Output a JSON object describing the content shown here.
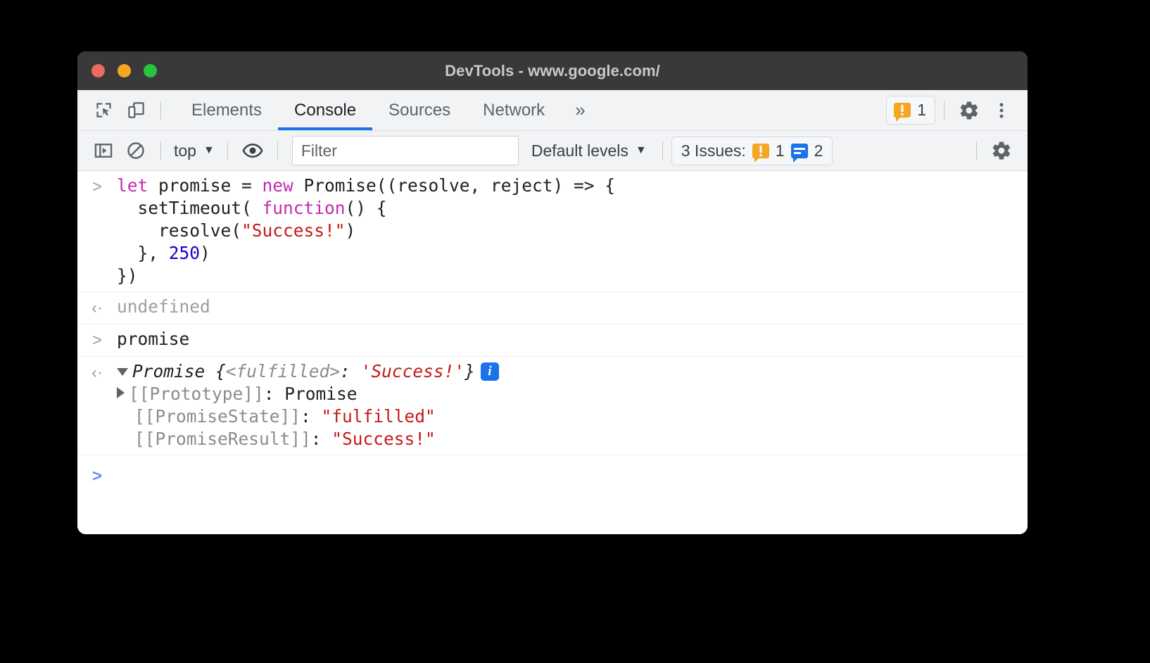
{
  "window": {
    "title": "DevTools - www.google.com/",
    "traffic_lights": [
      "close",
      "minimize",
      "maximize"
    ]
  },
  "tabbar": {
    "inspect_icon": "inspect-element-icon",
    "device_icon": "device-toolbar-icon",
    "tabs": [
      {
        "label": "Elements",
        "active": false
      },
      {
        "label": "Console",
        "active": true
      },
      {
        "label": "Sources",
        "active": false
      },
      {
        "label": "Network",
        "active": false
      }
    ],
    "more_tabs": "»",
    "warning_badge": {
      "icon": "warning-icon",
      "count": "1"
    },
    "settings_icon": "gear-icon",
    "menu_icon": "kebab-menu-icon"
  },
  "console_toolbar": {
    "sidebar_icon": "console-sidebar-icon",
    "clear_icon": "clear-console-icon",
    "context": {
      "label": "top",
      "caret": "▼"
    },
    "eye_icon": "live-expression-eye-icon",
    "filter": {
      "placeholder": "Filter",
      "value": ""
    },
    "levels": {
      "label": "Default levels",
      "caret": "▼"
    },
    "issues": {
      "label": "3 Issues:",
      "warning_count": "1",
      "info_count": "2"
    },
    "settings_icon": "console-settings-gear-icon"
  },
  "console": {
    "messages": [
      {
        "type": "input",
        "gutter": ">",
        "lines": [
          [
            {
              "t": "let ",
              "c": "k-kw"
            },
            {
              "t": "promise = ",
              "c": ""
            },
            {
              "t": "new ",
              "c": "k-kw"
            },
            {
              "t": "Promise((resolve, reject) => {",
              "c": ""
            }
          ],
          [
            {
              "t": "  setTimeout( ",
              "c": ""
            },
            {
              "t": "function",
              "c": "k-kw"
            },
            {
              "t": "() {",
              "c": ""
            }
          ],
          [
            {
              "t": "    resolve(",
              "c": ""
            },
            {
              "t": "\"Success!\"",
              "c": "k-str"
            },
            {
              "t": ")",
              "c": ""
            }
          ],
          [
            {
              "t": "  }, ",
              "c": ""
            },
            {
              "t": "250",
              "c": "k-num"
            },
            {
              "t": ")",
              "c": ""
            }
          ],
          [
            {
              "t": "})",
              "c": ""
            }
          ]
        ]
      },
      {
        "type": "output",
        "gutter": "‹·",
        "lines": [
          [
            {
              "t": "undefined",
              "c": "k-gray"
            }
          ]
        ]
      },
      {
        "type": "input",
        "gutter": ">",
        "lines": [
          [
            {
              "t": "promise",
              "c": ""
            }
          ]
        ]
      },
      {
        "type": "output-object",
        "gutter": "‹·",
        "header": [
          {
            "t": "Promise ",
            "c": "k-obj"
          },
          {
            "t": "{",
            "c": "k-obj"
          },
          {
            "t": "<fulfilled>",
            "c": "k-gray-i"
          },
          {
            "t": ": ",
            "c": "k-obj"
          },
          {
            "t": "'Success!'",
            "c": "k-red-i"
          },
          {
            "t": "}",
            "c": "k-obj"
          }
        ],
        "info_chip": "i",
        "properties": [
          {
            "expandable": true,
            "parts": [
              {
                "t": "[[Prototype]]",
                "c": "k-prop"
              },
              {
                "t": ": ",
                "c": ""
              },
              {
                "t": "Promise",
                "c": ""
              }
            ]
          },
          {
            "expandable": false,
            "parts": [
              {
                "t": "[[PromiseState]]",
                "c": "k-prop"
              },
              {
                "t": ": ",
                "c": ""
              },
              {
                "t": "\"fulfilled\"",
                "c": "k-str"
              }
            ]
          },
          {
            "expandable": false,
            "parts": [
              {
                "t": "[[PromiseResult]]",
                "c": "k-prop"
              },
              {
                "t": ": ",
                "c": ""
              },
              {
                "t": "\"Success!\"",
                "c": "k-str"
              }
            ]
          }
        ]
      }
    ],
    "prompt": ">"
  },
  "colors": {
    "accent_blue": "#1a73e8",
    "warning_orange": "#f5a623",
    "string_red": "#c41a16",
    "keyword_magenta": "#c32bb0",
    "number_blue": "#1c00cf",
    "titlebar": "#393939",
    "toolbar_bg": "#f1f3f4"
  }
}
